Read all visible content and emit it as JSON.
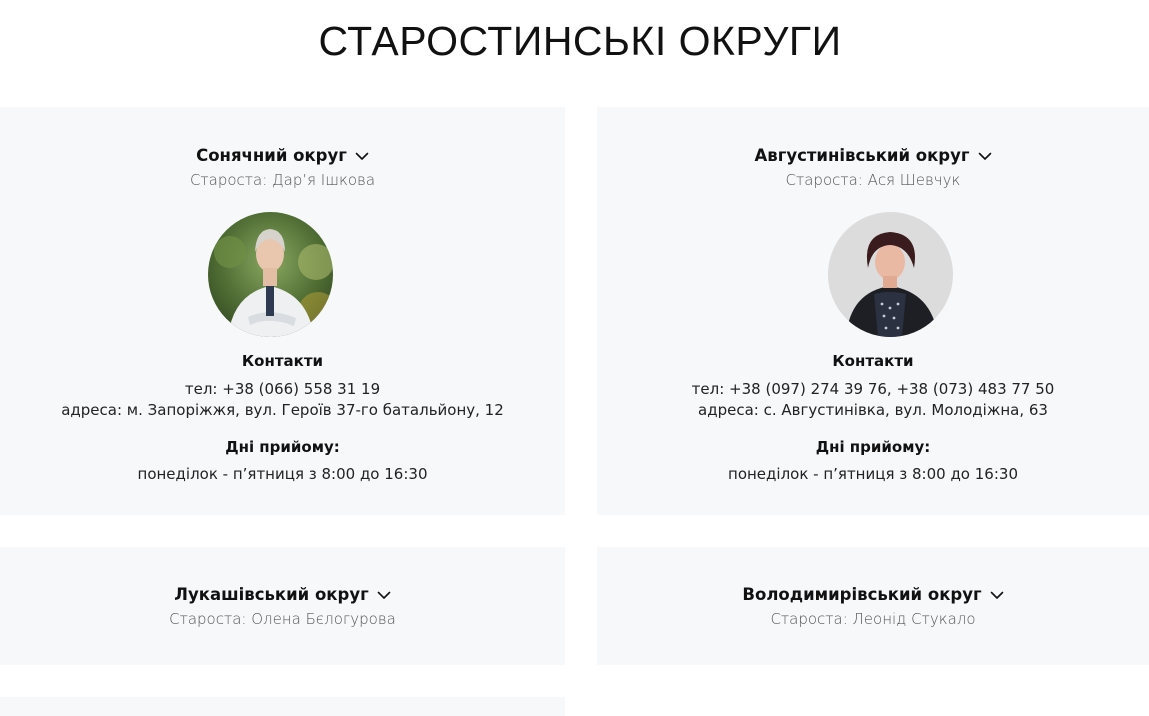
{
  "page": {
    "title": "СТАРОСТИНСЬКІ ОКРУГИ"
  },
  "districts": [
    {
      "name": "Сонячний округ",
      "elder": "Староста: Дар’я Ішкова",
      "contacts_title": "Контакти",
      "phone": "тел: +38 (066) 558 31 19",
      "address": "адреса: м. Запоріжжя, вул. Героїв 37-го батальйону, 12",
      "reception_title": "Дні прийому:",
      "reception_hours": "понеділок - п’ятниця з 8:00 до 16:30",
      "expanded": true
    },
    {
      "name": "Августинівський округ",
      "elder": "Староста: Ася Шевчук",
      "contacts_title": "Контакти",
      "phone": "тел: +38 (097) 274 39 76, +38 (073) 483 77 50",
      "address": "адреса: с. Августинівка, вул. Молодіжна, 63",
      "reception_title": "Дні прийому:",
      "reception_hours": "понеділок - п’ятниця з 8:00 до 16:30",
      "expanded": true
    },
    {
      "name": "Лукашівський округ",
      "elder": "Староста: Олена Бєлогурова",
      "expanded": false
    },
    {
      "name": "Володимирівський округ",
      "elder": "Староста: Леонід Стукало",
      "expanded": false
    }
  ],
  "icons": {
    "expand": "chevron-down-icon"
  }
}
